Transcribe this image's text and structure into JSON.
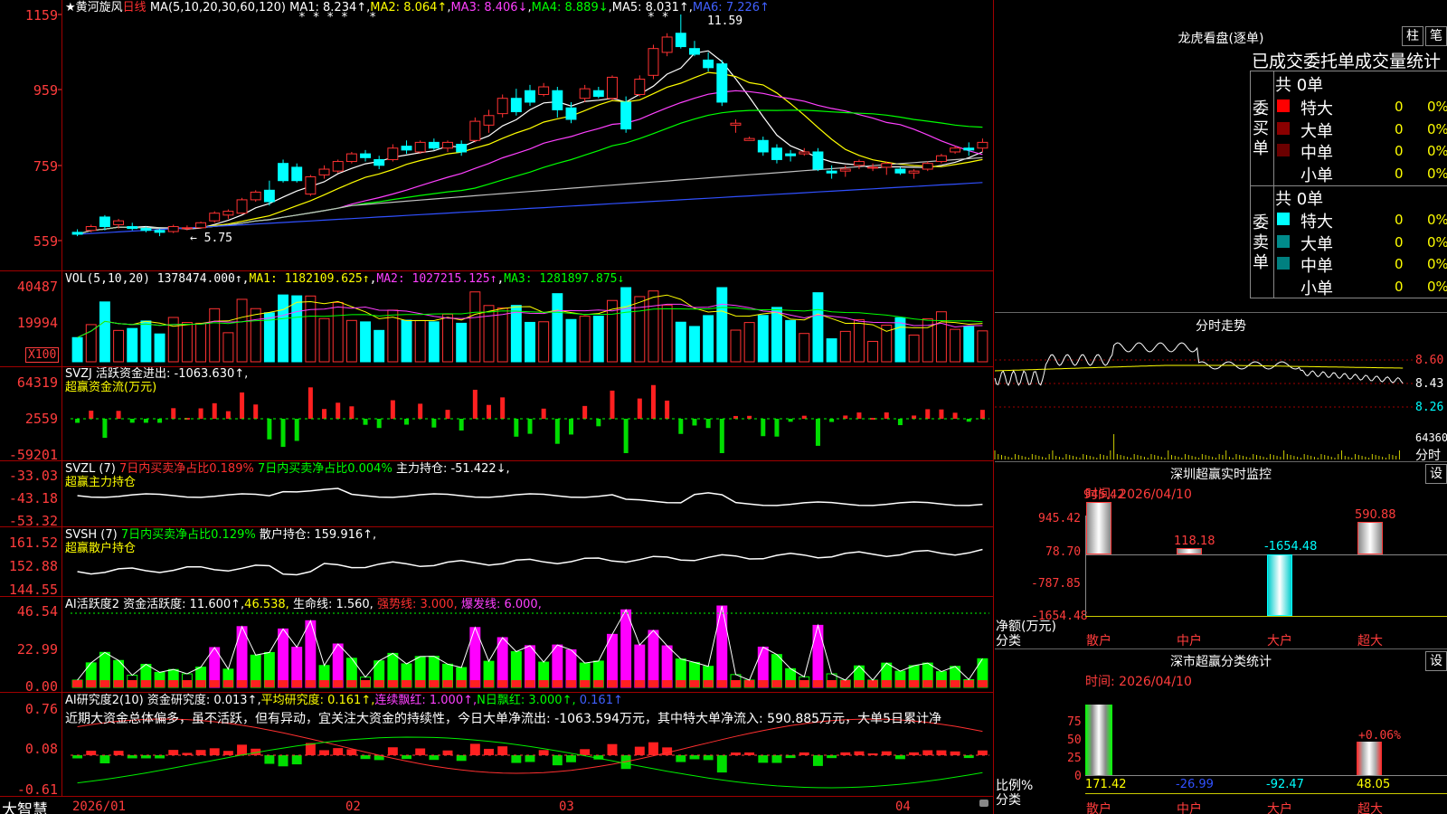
{
  "main": {
    "star": "★",
    "stock_name": "黄河旋风",
    "period": "日线",
    "ma_label": "MA(5,10,20,30,60,120)",
    "ma1": "MA1: 8.234↑",
    "ma2": "MA2: 8.064↑",
    "ma3": "MA3: 8.406↓",
    "ma4": "MA4: 8.889↓",
    "ma5": "MA5: 8.031↑",
    "ma6": "MA6: 7.226↑",
    "stars": "* * * *   *",
    "stars2": "* *",
    "hi_note": "11.59",
    "lo_note": "← 5.75",
    "y_labels": [
      "1159",
      "959",
      "759",
      "559"
    ]
  },
  "vol": {
    "label": "VOL(5,10,20)",
    "value": "1378474.000↑",
    "ma1": "MA1: 1182109.625↑",
    "ma2": "MA2: 1027215.125↑",
    "ma3": "MA3: 1281897.875↓",
    "y_labels": [
      "40487",
      "19994"
    ],
    "x100": "X100"
  },
  "svzj": {
    "label": "SVZJ  活跃资金进出: -1063.630↑,",
    "sub": "超赢资金流(万元)",
    "y_labels": [
      "64319",
      "2559",
      "-59201"
    ]
  },
  "svzl": {
    "label": "SVZL (7)",
    "t1": "7日内买卖净占比0.189%",
    "t2": "7日内买卖净占比0.004%",
    "t3": "主力持仓: -51.422↓,",
    "sub": "超赢主力持仓",
    "y_labels": [
      "-33.03",
      "-43.18",
      "-53.32"
    ]
  },
  "svsh": {
    "label": "SVSH (7)",
    "t1": "7日内买卖净占比0.129%",
    "t2": "散户持仓: 159.916↑,",
    "sub": "超赢散户持仓",
    "y_labels": [
      "161.52",
      "152.88",
      "144.55"
    ]
  },
  "ai2": {
    "label": "AI活跃度2",
    "t1": "资金活跃度: 11.600↑,",
    "t2": "46.538,",
    "t3": "生命线: 1.560,",
    "t4": "强势线: 3.000,",
    "t5": "爆发线: 6.000,",
    "y_labels": [
      "46.54",
      "22.99",
      "0.00"
    ]
  },
  "ai_research": {
    "label": "AI研究度2(10)",
    "t1": "资金研究度: 0.013↑,",
    "t2": "平均研究度: 0.161↑,",
    "t3": "连续飘红: 1.000↑,",
    "t4": "N日飘红: 3.000↑,",
    "t5": "0.161↑",
    "comment": "近期大资金总体偏多，虽不活跃，但有异动，宜关注大资金的持续性，今日大单净流出: -1063.594万元，其中特大单净流入: 590.885万元，大单5日累计净",
    "y_labels": [
      "0.76",
      "0.08",
      "-0.61"
    ]
  },
  "x_axis": {
    "brand": "大智慧",
    "labels": [
      "2026/01",
      "02",
      "03",
      "04"
    ]
  },
  "lhb": {
    "title": "龙虎看盘(逐单)",
    "btn_zhu": "柱",
    "btn_bi": "笔",
    "header": "已成交委托单成交量统计",
    "buy_total": "共 0单",
    "sell_total": "共 0单",
    "buy_side": "委买单",
    "sell_side": "委卖单",
    "rows": [
      {
        "label": "特大",
        "v": "0",
        "p": "0%"
      },
      {
        "label": "大单",
        "v": "0",
        "p": "0%"
      },
      {
        "label": "中单",
        "v": "0",
        "p": "0%"
      },
      {
        "label": "小单",
        "v": "0",
        "p": "0%"
      }
    ],
    "buy_colors": [
      "#ff0000",
      "#8b0000",
      "#6b0000",
      ""
    ],
    "sell_colors": [
      "#00ffff",
      "#008b8b",
      "#008080",
      ""
    ]
  },
  "intraday": {
    "title": "分时走势",
    "y_labels": [
      "8.60",
      "8.43",
      "8.26",
      "64360",
      "分时"
    ]
  },
  "sz_monitor": {
    "title": "深圳超赢实时监控",
    "btn": "设",
    "time": "时间: 2026/04/10",
    "y_labels": [
      "945.42",
      "78.70",
      "-787.85",
      "-1654.48"
    ],
    "ylabel": "净额(万元)",
    "xlabel": "分类",
    "categories": [
      "散户",
      "中户",
      "大户",
      "超大"
    ],
    "value_labels": [
      "945.42",
      "118.18",
      "-1654.48",
      "590.88"
    ]
  },
  "sz_class": {
    "title": "深市超赢分类统计",
    "btn": "设",
    "time": "时间: 2026/04/10",
    "y_labels": [
      "75",
      "50",
      "25",
      "0"
    ],
    "ylabel": "比例%",
    "xlabel": "分类",
    "categories": [
      "散户",
      "中户",
      "大户",
      "超大"
    ],
    "top_label": "+0.06%",
    "value_labels": [
      "171.42",
      "-26.99",
      "-92.47",
      "48.05"
    ]
  },
  "chart_data": [
    {
      "type": "candlestick",
      "title": "黄河旋风 日线",
      "x": [
        "2026/01",
        "02",
        "03",
        "04"
      ],
      "ylim": [
        5.59,
        11.59
      ],
      "hi": 11.59,
      "lo": 5.75,
      "ohlc": [
        [
          5.9,
          5.98,
          5.8,
          5.85
        ],
        [
          5.95,
          6.1,
          5.9,
          6.05
        ],
        [
          6.3,
          6.35,
          5.95,
          6.05
        ],
        [
          6.1,
          6.25,
          6.0,
          6.2
        ],
        [
          6.05,
          6.15,
          5.95,
          6.0
        ],
        [
          6.0,
          6.05,
          5.9,
          5.95
        ],
        [
          5.95,
          6.0,
          5.8,
          5.9
        ],
        [
          5.92,
          6.1,
          5.88,
          6.05
        ],
        [
          6.0,
          6.08,
          5.95,
          6.02
        ],
        [
          6.02,
          6.18,
          6.0,
          6.15
        ],
        [
          6.2,
          6.45,
          6.15,
          6.4
        ],
        [
          6.35,
          6.5,
          6.25,
          6.45
        ],
        [
          6.4,
          6.8,
          6.38,
          6.75
        ],
        [
          6.75,
          7.0,
          6.7,
          6.95
        ],
        [
          7.0,
          7.25,
          6.6,
          6.7
        ],
        [
          7.7,
          7.8,
          7.2,
          7.25
        ],
        [
          7.6,
          7.7,
          7.2,
          7.25
        ],
        [
          6.9,
          7.4,
          6.85,
          7.35
        ],
        [
          7.4,
          7.65,
          7.3,
          7.55
        ],
        [
          7.5,
          7.8,
          7.45,
          7.75
        ],
        [
          7.75,
          8.0,
          7.7,
          7.95
        ],
        [
          7.95,
          8.05,
          7.75,
          7.85
        ],
        [
          7.8,
          7.9,
          7.55,
          7.65
        ],
        [
          7.8,
          8.2,
          7.75,
          8.1
        ],
        [
          8.15,
          8.3,
          7.95,
          8.05
        ],
        [
          8.0,
          8.3,
          7.95,
          8.25
        ],
        [
          8.25,
          8.35,
          8.05,
          8.1
        ],
        [
          8.1,
          8.3,
          8.0,
          8.25
        ],
        [
          8.2,
          8.3,
          7.9,
          8.0
        ],
        [
          8.3,
          8.9,
          8.25,
          8.8
        ],
        [
          8.7,
          9.1,
          8.5,
          8.95
        ],
        [
          9.0,
          9.5,
          8.9,
          9.4
        ],
        [
          9.4,
          9.65,
          8.95,
          9.05
        ],
        [
          9.6,
          9.75,
          9.2,
          9.3
        ],
        [
          9.5,
          9.8,
          9.45,
          9.7
        ],
        [
          9.6,
          9.7,
          8.9,
          9.1
        ],
        [
          9.15,
          9.3,
          8.75,
          8.85
        ],
        [
          9.4,
          9.75,
          9.3,
          9.65
        ],
        [
          9.6,
          9.7,
          9.4,
          9.45
        ],
        [
          9.4,
          10.0,
          9.35,
          9.95
        ],
        [
          9.3,
          9.45,
          8.5,
          8.6
        ],
        [
          9.5,
          10.0,
          9.45,
          9.9
        ],
        [
          10.0,
          10.8,
          9.9,
          10.7
        ],
        [
          10.6,
          11.1,
          10.5,
          11.0
        ],
        [
          11.1,
          11.59,
          10.7,
          10.75
        ],
        [
          10.7,
          10.9,
          10.5,
          10.55
        ],
        [
          10.4,
          10.6,
          10.1,
          10.2
        ],
        [
          10.3,
          10.4,
          9.2,
          9.3
        ],
        [
          8.7,
          8.85,
          8.5,
          8.75
        ],
        [
          8.3,
          8.4,
          8.3,
          8.35
        ],
        [
          8.3,
          8.4,
          7.9,
          8.0
        ],
        [
          8.1,
          8.2,
          7.7,
          7.8
        ],
        [
          7.95,
          8.05,
          7.75,
          7.9
        ],
        [
          7.95,
          8.1,
          7.9,
          8.0
        ],
        [
          8.0,
          8.1,
          7.5,
          7.55
        ],
        [
          7.5,
          7.65,
          7.3,
          7.45
        ],
        [
          7.5,
          7.65,
          7.35,
          7.55
        ],
        [
          7.65,
          7.8,
          7.55,
          7.75
        ],
        [
          7.6,
          7.7,
          7.5,
          7.6
        ],
        [
          7.6,
          7.75,
          7.4,
          7.7
        ],
        [
          7.55,
          7.6,
          7.4,
          7.45
        ],
        [
          7.45,
          7.55,
          7.3,
          7.5
        ],
        [
          7.55,
          7.75,
          7.5,
          7.7
        ],
        [
          7.75,
          7.95,
          7.7,
          7.9
        ],
        [
          8.0,
          8.15,
          7.95,
          8.1
        ],
        [
          8.1,
          8.25,
          7.9,
          8.05
        ],
        [
          8.1,
          8.35,
          8.0,
          8.25
        ]
      ],
      "ma": [
        {
          "name": "MA1",
          "color": "#ffffff"
        },
        {
          "name": "MA2",
          "color": "#ffff00"
        },
        {
          "name": "MA3",
          "color": "#ff40ff"
        },
        {
          "name": "MA4",
          "color": "#00ff00"
        },
        {
          "name": "MA5",
          "color": "#c0c0c0"
        },
        {
          "name": "MA6",
          "color": "#3050ff"
        }
      ]
    }
  ]
}
